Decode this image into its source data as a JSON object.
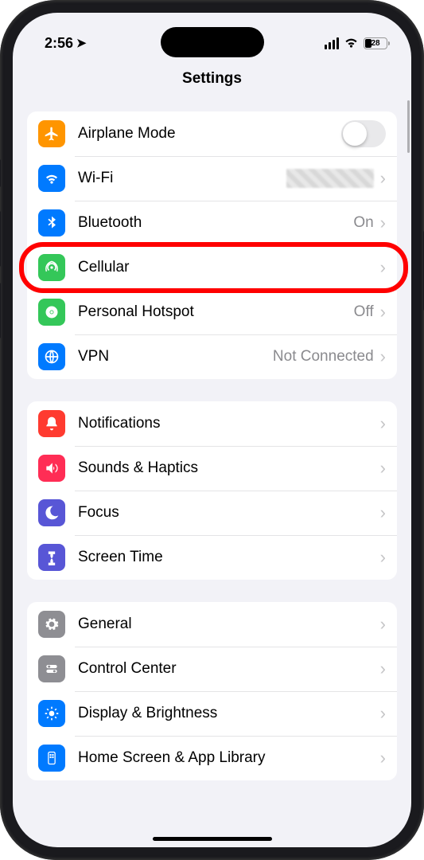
{
  "status": {
    "time": "2:56",
    "battery_percent": "28"
  },
  "header": {
    "title": "Settings"
  },
  "groups": [
    {
      "rows": [
        {
          "id": "airplane",
          "label": "Airplane Mode",
          "icon_bg": "bg-orange",
          "control": "toggle"
        },
        {
          "id": "wifi",
          "label": "Wi-Fi",
          "icon_bg": "bg-blue",
          "detail": "",
          "blur": true,
          "chevron": true
        },
        {
          "id": "bluetooth",
          "label": "Bluetooth",
          "icon_bg": "bg-blue",
          "detail": "On",
          "chevron": true
        },
        {
          "id": "cellular",
          "label": "Cellular",
          "icon_bg": "bg-green",
          "chevron": true,
          "highlighted": true
        },
        {
          "id": "hotspot",
          "label": "Personal Hotspot",
          "icon_bg": "bg-green",
          "detail": "Off",
          "chevron": true
        },
        {
          "id": "vpn",
          "label": "VPN",
          "icon_bg": "bg-blue",
          "detail": "Not Connected",
          "chevron": true
        }
      ]
    },
    {
      "rows": [
        {
          "id": "notifications",
          "label": "Notifications",
          "icon_bg": "bg-red",
          "chevron": true
        },
        {
          "id": "sounds",
          "label": "Sounds & Haptics",
          "icon_bg": "bg-pink",
          "chevron": true
        },
        {
          "id": "focus",
          "label": "Focus",
          "icon_bg": "bg-indigo",
          "chevron": true
        },
        {
          "id": "screentime",
          "label": "Screen Time",
          "icon_bg": "bg-indigo",
          "chevron": true
        }
      ]
    },
    {
      "rows": [
        {
          "id": "general",
          "label": "General",
          "icon_bg": "bg-gray",
          "chevron": true
        },
        {
          "id": "controlcenter",
          "label": "Control Center",
          "icon_bg": "bg-gray",
          "chevron": true
        },
        {
          "id": "display",
          "label": "Display & Brightness",
          "icon_bg": "bg-blue",
          "chevron": true
        },
        {
          "id": "homescreen",
          "label": "Home Screen & App Library",
          "icon_bg": "bg-blue",
          "chevron": true
        }
      ]
    }
  ],
  "icons": {
    "airplane": "<path d='M21 16v-2l-8-5V3.5a1.5 1.5 0 0 0-3 0V9l-8 5v2l8-2.5V19l-2 1.5V22l3.5-1 3.5 1v-1.5L13 19v-5.5z'/>",
    "wifi": "<path d='M12 20a2 2 0 1 0 0-4 2 2 0 0 0 0 4zm-5-6a7 7 0 0 1 10 0l-2 2a4.2 4.2 0 0 0-6 0zm-3.5-3.5a12 12 0 0 1 17 0l-2 2a9.2 9.2 0 0 0-13 0z'/>",
    "bluetooth": "<path d='M12 2l6 5-4.5 4 4.5 4-6 5v-7.5L8 16l-1.5-1.5L11 11 6.5 7 8 5.5l4 3.5z' fill-rule='evenodd'/>",
    "cellular": "<path d='M12 7a5 5 0 0 0-5 5c0 1.4.6 2.6 1.5 3.5l-1.4 1.4A7 7 0 0 1 12 5a7 7 0 0 1 5 11.9l-1.4-1.4A5 5 0 0 0 12 7zm0 3a2 2 0 1 1 0 4 2 2 0 0 1 0-4zm-8.5 8.5A12 12 0 0 1 12 2a12 12 0 0 1 8.5 16.5l-1.4-1.4A10 10 0 0 0 12 4a10 10 0 0 0-7.1 13.1z'/>",
    "hotspot": "<path d='M8 12a4 4 0 1 1 8 0 4 4 0 0 1-8 0zm-4 0a8 8 0 1 1 16 0 8 8 0 0 1-16 0zm2 0a6 6 0 1 0 12 0 6 6 0 0 0-12 0z' fill='none' stroke='white' stroke-width='2'/><circle cx='12' cy='12' r='2'/>",
    "vpn": "<circle cx='12' cy='12' r='9' fill='none' stroke='white' stroke-width='2'/><path d='M3 12h18M12 3c3 3 3 15 0 18M12 3c-3 3-3 15 0 18' stroke='white' stroke-width='2' fill='none'/>",
    "notifications": "<path d='M12 2a6 6 0 0 0-6 6v4l-2 3v1h16v-1l-2-3V8a6 6 0 0 0-6-6zm0 20a2.5 2.5 0 0 0 2.5-2.5h-5A2.5 2.5 0 0 0 12 22z'/>",
    "sounds": "<path d='M4 9v6h4l5 5V4L8 9zm12 3a3 3 0 0 0-1.5-2.6v5.2A3 3 0 0 0 16 12zm1.5-6.7v2.1a6 6 0 0 1 0 9.2v2.1a8 8 0 0 0 0-13.4z'/>",
    "focus": "<path d='M14 2a10 10 0 1 0 8 14 8 8 0 0 1-8-14z'/>",
    "screentime": "<path d='M7 3h10v4h-3v2a6 6 0 0 1-2 4.5A6 6 0 0 1 14 18v2h3v4H7v-4h3v-2a6 6 0 0 1 2-4.5A6 6 0 0 1 10 9V7H7z' fill='white'/>",
    "general": "<path d='M12 8a4 4 0 1 0 0 8 4 4 0 0 0 0-8zm8 4l2 1-1 3-2.5-.5-1.5 1.5.5 2.5-3 1-1-2h-2l-1 2-3-1 .5-2.5L6.5 16 4 16.5 3 13.5l2-1v-1l-2-1 1-3 2.5.5L8 6.5 7.5 4l3-1 1 2h2l1-2 3 1L17 6.5 18.5 8l2.5-.5 1 3-2 1z' fill='white'/>",
    "controlcenter": "<rect x='4' y='6' width='16' height='5' rx='2.5' fill='white'/><rect x='4' y='13' width='16' height='5' rx='2.5' fill='white'/><circle cx='8' cy='8.5' r='1.8' fill='#8e8e93'/><circle cx='16' cy='15.5' r='1.8' fill='#8e8e93'/>",
    "display": "<circle cx='12' cy='12' r='4'/><path d='M12 2v3M12 19v3M2 12h3M19 12h3M5 5l2 2M17 17l2 2M19 5l-2 2M7 17l-2 2' stroke='white' stroke-width='2'/>",
    "homescreen": "<rect x='7' y='3' width='10' height='18' rx='2' fill='none' stroke='white' stroke-width='1.5'/><rect x='9' y='6' width='2.5' height='2.5' rx='.5'/><rect x='12.5' y='6' width='2.5' height='2.5' rx='.5'/><rect x='9' y='9.5' width='2.5' height='2.5' rx='.5'/><rect x='12.5' y='9.5' width='2.5' height='2.5' rx='.5'/>"
  }
}
